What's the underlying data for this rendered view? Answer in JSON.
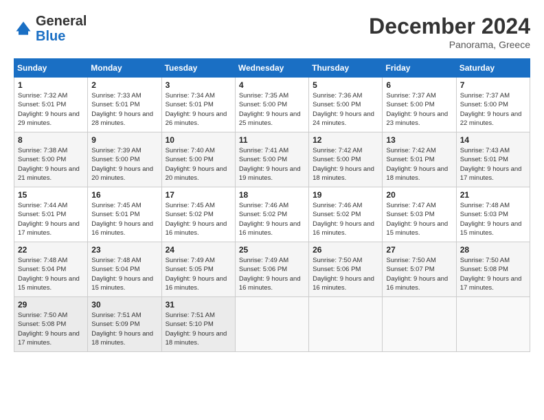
{
  "header": {
    "logo_line1": "General",
    "logo_line2": "Blue",
    "month_title": "December 2024",
    "location": "Panorama, Greece"
  },
  "weekdays": [
    "Sunday",
    "Monday",
    "Tuesday",
    "Wednesday",
    "Thursday",
    "Friday",
    "Saturday"
  ],
  "weeks": [
    [
      {
        "day": "1",
        "sunrise": "7:32 AM",
        "sunset": "5:01 PM",
        "daylight": "9 hours and 29 minutes."
      },
      {
        "day": "2",
        "sunrise": "7:33 AM",
        "sunset": "5:01 PM",
        "daylight": "9 hours and 28 minutes."
      },
      {
        "day": "3",
        "sunrise": "7:34 AM",
        "sunset": "5:01 PM",
        "daylight": "9 hours and 26 minutes."
      },
      {
        "day": "4",
        "sunrise": "7:35 AM",
        "sunset": "5:00 PM",
        "daylight": "9 hours and 25 minutes."
      },
      {
        "day": "5",
        "sunrise": "7:36 AM",
        "sunset": "5:00 PM",
        "daylight": "9 hours and 24 minutes."
      },
      {
        "day": "6",
        "sunrise": "7:37 AM",
        "sunset": "5:00 PM",
        "daylight": "9 hours and 23 minutes."
      },
      {
        "day": "7",
        "sunrise": "7:37 AM",
        "sunset": "5:00 PM",
        "daylight": "9 hours and 22 minutes."
      }
    ],
    [
      {
        "day": "8",
        "sunrise": "7:38 AM",
        "sunset": "5:00 PM",
        "daylight": "9 hours and 21 minutes."
      },
      {
        "day": "9",
        "sunrise": "7:39 AM",
        "sunset": "5:00 PM",
        "daylight": "9 hours and 20 minutes."
      },
      {
        "day": "10",
        "sunrise": "7:40 AM",
        "sunset": "5:00 PM",
        "daylight": "9 hours and 20 minutes."
      },
      {
        "day": "11",
        "sunrise": "7:41 AM",
        "sunset": "5:00 PM",
        "daylight": "9 hours and 19 minutes."
      },
      {
        "day": "12",
        "sunrise": "7:42 AM",
        "sunset": "5:00 PM",
        "daylight": "9 hours and 18 minutes."
      },
      {
        "day": "13",
        "sunrise": "7:42 AM",
        "sunset": "5:01 PM",
        "daylight": "9 hours and 18 minutes."
      },
      {
        "day": "14",
        "sunrise": "7:43 AM",
        "sunset": "5:01 PM",
        "daylight": "9 hours and 17 minutes."
      }
    ],
    [
      {
        "day": "15",
        "sunrise": "7:44 AM",
        "sunset": "5:01 PM",
        "daylight": "9 hours and 17 minutes."
      },
      {
        "day": "16",
        "sunrise": "7:45 AM",
        "sunset": "5:01 PM",
        "daylight": "9 hours and 16 minutes."
      },
      {
        "day": "17",
        "sunrise": "7:45 AM",
        "sunset": "5:02 PM",
        "daylight": "9 hours and 16 minutes."
      },
      {
        "day": "18",
        "sunrise": "7:46 AM",
        "sunset": "5:02 PM",
        "daylight": "9 hours and 16 minutes."
      },
      {
        "day": "19",
        "sunrise": "7:46 AM",
        "sunset": "5:02 PM",
        "daylight": "9 hours and 16 minutes."
      },
      {
        "day": "20",
        "sunrise": "7:47 AM",
        "sunset": "5:03 PM",
        "daylight": "9 hours and 15 minutes."
      },
      {
        "day": "21",
        "sunrise": "7:48 AM",
        "sunset": "5:03 PM",
        "daylight": "9 hours and 15 minutes."
      }
    ],
    [
      {
        "day": "22",
        "sunrise": "7:48 AM",
        "sunset": "5:04 PM",
        "daylight": "9 hours and 15 minutes."
      },
      {
        "day": "23",
        "sunrise": "7:48 AM",
        "sunset": "5:04 PM",
        "daylight": "9 hours and 15 minutes."
      },
      {
        "day": "24",
        "sunrise": "7:49 AM",
        "sunset": "5:05 PM",
        "daylight": "9 hours and 16 minutes."
      },
      {
        "day": "25",
        "sunrise": "7:49 AM",
        "sunset": "5:06 PM",
        "daylight": "9 hours and 16 minutes."
      },
      {
        "day": "26",
        "sunrise": "7:50 AM",
        "sunset": "5:06 PM",
        "daylight": "9 hours and 16 minutes."
      },
      {
        "day": "27",
        "sunrise": "7:50 AM",
        "sunset": "5:07 PM",
        "daylight": "9 hours and 16 minutes."
      },
      {
        "day": "28",
        "sunrise": "7:50 AM",
        "sunset": "5:08 PM",
        "daylight": "9 hours and 17 minutes."
      }
    ],
    [
      {
        "day": "29",
        "sunrise": "7:50 AM",
        "sunset": "5:08 PM",
        "daylight": "9 hours and 17 minutes."
      },
      {
        "day": "30",
        "sunrise": "7:51 AM",
        "sunset": "5:09 PM",
        "daylight": "9 hours and 18 minutes."
      },
      {
        "day": "31",
        "sunrise": "7:51 AM",
        "sunset": "5:10 PM",
        "daylight": "9 hours and 18 minutes."
      },
      null,
      null,
      null,
      null
    ]
  ],
  "labels": {
    "sunrise": "Sunrise:",
    "sunset": "Sunset:",
    "daylight": "Daylight:"
  }
}
